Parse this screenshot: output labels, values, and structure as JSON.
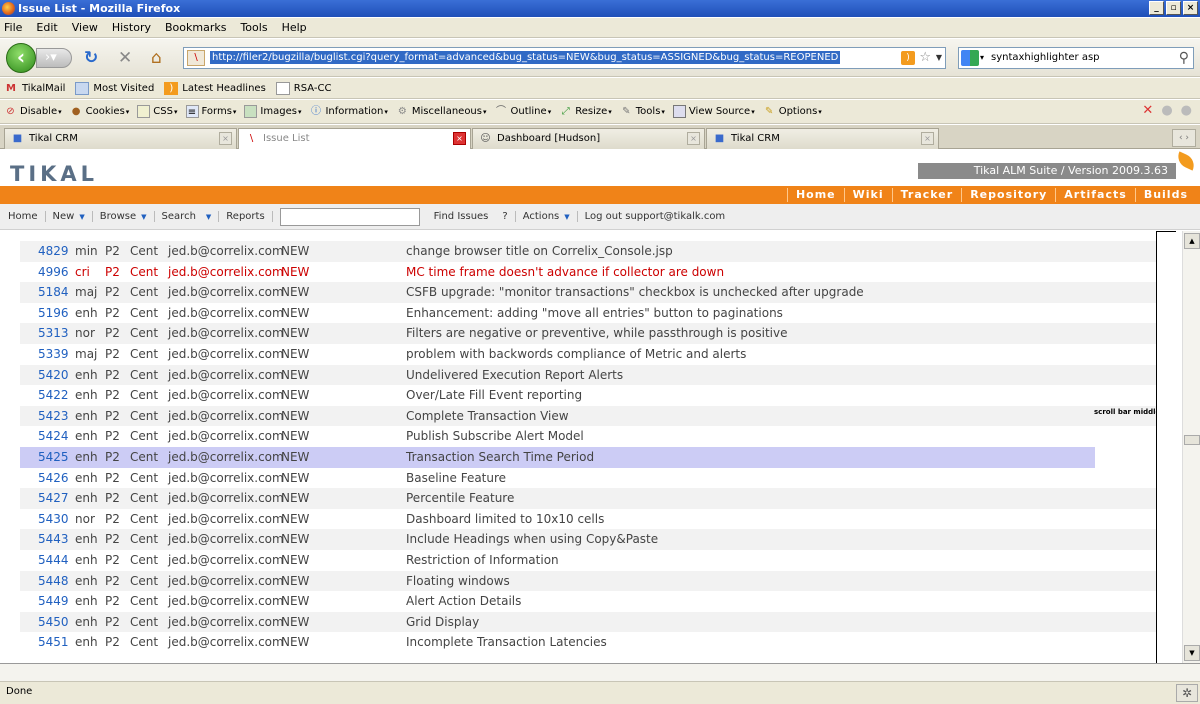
{
  "window": {
    "title": "Issue List - Mozilla Firefox",
    "min": "_",
    "max": "▫",
    "close": "×"
  },
  "menu": [
    "File",
    "Edit",
    "View",
    "History",
    "Bookmarks",
    "Tools",
    "Help"
  ],
  "nav": {
    "url": "http://filer2/bugzilla/buglist.cgi?query_format=advanced&bug_status=NEW&bug_status=ASSIGNED&bug_status=REOPENED",
    "search": "syntaxhighlighter asp"
  },
  "bookmarks": [
    "TikalMail",
    "Most Visited",
    "Latest Headlines",
    "RSA-CC"
  ],
  "devtools": [
    "Disable",
    "Cookies",
    "CSS",
    "Forms",
    "Images",
    "Information",
    "Miscellaneous",
    "Outline",
    "Resize",
    "Tools",
    "View Source",
    "Options"
  ],
  "tabs": [
    {
      "label": "Tikal CRM"
    },
    {
      "label": "Issue List"
    },
    {
      "label": "Dashboard [Hudson]"
    },
    {
      "label": "Tikal CRM"
    }
  ],
  "app": {
    "logo": "TIKAL",
    "suite": "Tikal ALM Suite / Version 2009.3.63",
    "nav": [
      "Home",
      "Wiki",
      "Tracker",
      "Repository",
      "Artifacts",
      "Builds"
    ]
  },
  "bugzilla": {
    "home": "Home",
    "new": "New",
    "browse": "Browse",
    "search": "Search",
    "reports": "Reports",
    "find": "Find Issues",
    "help": "?",
    "actions": "Actions",
    "logout": "Log out support@tikalk.com"
  },
  "rows": [
    {
      "id": "4829",
      "sev": "min",
      "pri": "P2",
      "os": "Cent",
      "assignee": "jed.b@correlix.com",
      "status": "NEW",
      "summary": "change browser title on Correlix_Console.jsp"
    },
    {
      "id": "4996",
      "sev": "cri",
      "pri": "P2",
      "os": "Cent",
      "assignee": "jed.b@correlix.com",
      "status": "NEW",
      "summary": "MC time frame doesn't advance if collector are down"
    },
    {
      "id": "5184",
      "sev": "maj",
      "pri": "P2",
      "os": "Cent",
      "assignee": "jed.b@correlix.com",
      "status": "NEW",
      "summary": "CSFB upgrade: \"monitor transactions\" checkbox is unchecked after upgrade"
    },
    {
      "id": "5196",
      "sev": "enh",
      "pri": "P2",
      "os": "Cent",
      "assignee": "jed.b@correlix.com",
      "status": "NEW",
      "summary": "Enhancement: adding \"move all entries\" button to paginations"
    },
    {
      "id": "5313",
      "sev": "nor",
      "pri": "P2",
      "os": "Cent",
      "assignee": "jed.b@correlix.com",
      "status": "NEW",
      "summary": "Filters are negative or preventive, while passthrough is positive"
    },
    {
      "id": "5339",
      "sev": "maj",
      "pri": "P2",
      "os": "Cent",
      "assignee": "jed.b@correlix.com",
      "status": "NEW",
      "summary": "problem with backwords compliance of Metric and alerts"
    },
    {
      "id": "5420",
      "sev": "enh",
      "pri": "P2",
      "os": "Cent",
      "assignee": "jed.b@correlix.com",
      "status": "NEW",
      "summary": "Undelivered Execution Report Alerts"
    },
    {
      "id": "5422",
      "sev": "enh",
      "pri": "P2",
      "os": "Cent",
      "assignee": "jed.b@correlix.com",
      "status": "NEW",
      "summary": "Over/Late Fill Event reporting"
    },
    {
      "id": "5423",
      "sev": "enh",
      "pri": "P2",
      "os": "Cent",
      "assignee": "jed.b@correlix.com",
      "status": "NEW",
      "summary": "Complete Transaction View"
    },
    {
      "id": "5424",
      "sev": "enh",
      "pri": "P2",
      "os": "Cent",
      "assignee": "jed.b@correlix.com",
      "status": "NEW",
      "summary": "Publish Subscribe Alert Model"
    },
    {
      "id": "5425",
      "sev": "enh",
      "pri": "P2",
      "os": "Cent",
      "assignee": "jed.b@correlix.com",
      "status": "NEW",
      "summary": "Transaction Search Time Period"
    },
    {
      "id": "5426",
      "sev": "enh",
      "pri": "P2",
      "os": "Cent",
      "assignee": "jed.b@correlix.com",
      "status": "NEW",
      "summary": "Baseline Feature"
    },
    {
      "id": "5427",
      "sev": "enh",
      "pri": "P2",
      "os": "Cent",
      "assignee": "jed.b@correlix.com",
      "status": "NEW",
      "summary": "Percentile Feature"
    },
    {
      "id": "5430",
      "sev": "nor",
      "pri": "P2",
      "os": "Cent",
      "assignee": "jed.b@correlix.com",
      "status": "NEW",
      "summary": "Dashboard limited to 10x10 cells"
    },
    {
      "id": "5443",
      "sev": "enh",
      "pri": "P2",
      "os": "Cent",
      "assignee": "jed.b@correlix.com",
      "status": "NEW",
      "summary": "Include Headings when using Copy&Paste"
    },
    {
      "id": "5444",
      "sev": "enh",
      "pri": "P2",
      "os": "Cent",
      "assignee": "jed.b@correlix.com",
      "status": "NEW",
      "summary": "Restriction of Information"
    },
    {
      "id": "5448",
      "sev": "enh",
      "pri": "P2",
      "os": "Cent",
      "assignee": "jed.b@correlix.com",
      "status": "NEW",
      "summary": "Floating windows"
    },
    {
      "id": "5449",
      "sev": "enh",
      "pri": "P2",
      "os": "Cent",
      "assignee": "jed.b@correlix.com",
      "status": "NEW",
      "summary": "Alert Action Details"
    },
    {
      "id": "5450",
      "sev": "enh",
      "pri": "P2",
      "os": "Cent",
      "assignee": "jed.b@correlix.com",
      "status": "NEW",
      "summary": "Grid Display"
    },
    {
      "id": "5451",
      "sev": "enh",
      "pri": "P2",
      "os": "Cent",
      "assignee": "jed.b@correlix.com",
      "status": "NEW",
      "summary": "Incomplete Transaction Latencies"
    }
  ],
  "note": "scroll bar middle:",
  "status": "Done"
}
